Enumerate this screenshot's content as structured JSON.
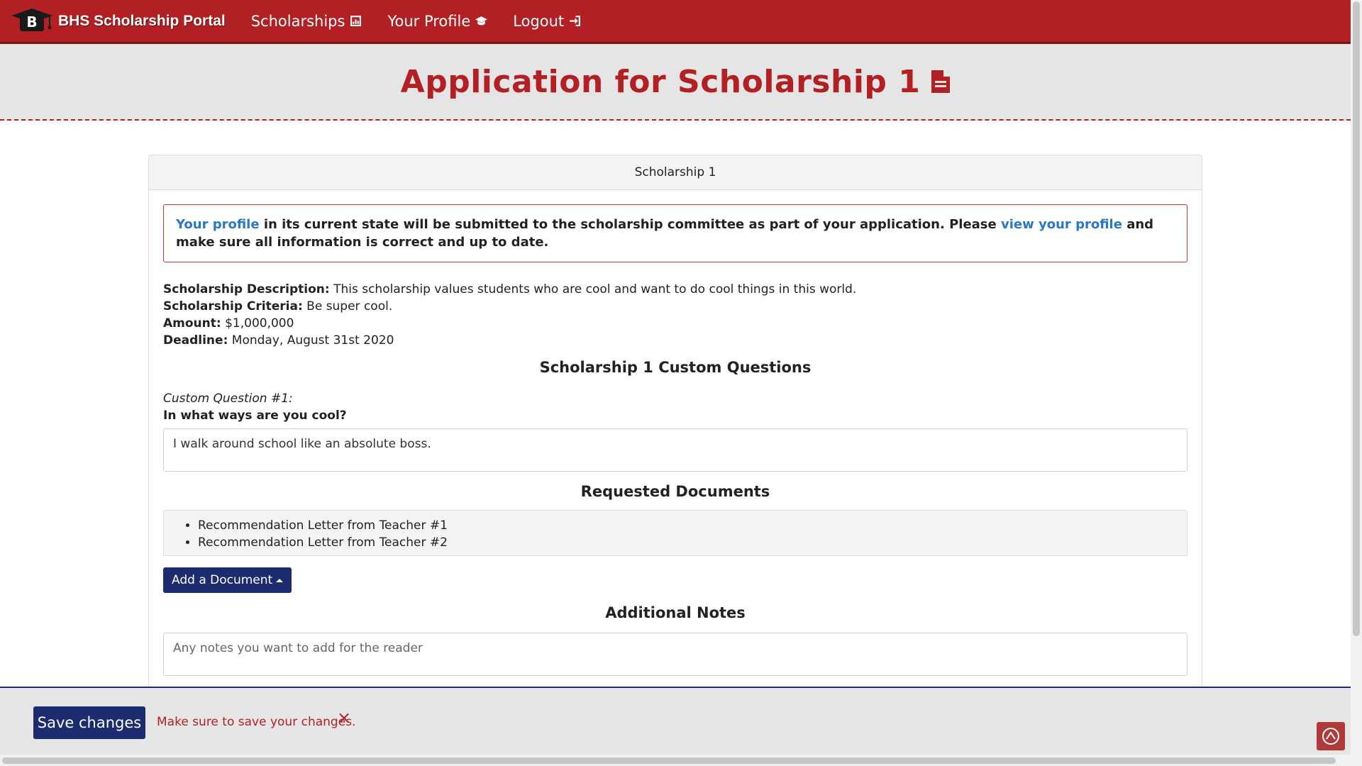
{
  "nav": {
    "brand_letter": "B",
    "brand_name": "BHS Scholarship Portal",
    "items": [
      {
        "label": "Scholarships",
        "icon": "chart-icon"
      },
      {
        "label": "Your Profile",
        "icon": "graduation-cap-icon"
      },
      {
        "label": "Logout",
        "icon": "logout-icon"
      }
    ]
  },
  "header": {
    "title": "Application for Scholarship 1",
    "icon": "document-icon"
  },
  "card": {
    "title": "Scholarship 1",
    "alert": {
      "link1": "Your profile",
      "text1": " in its current state will be submitted to the scholarship committee as part of your application. Please ",
      "link2": "view your profile",
      "text2": " and make sure all information is correct and up to date."
    },
    "info": {
      "description_label": "Scholarship Description:",
      "description_value": " This scholarship values students who are cool and want to do cool things in this world.",
      "criteria_label": "Scholarship Criteria:",
      "criteria_value": " Be super cool.",
      "amount_label": "Amount:",
      "amount_value": " $1,000,000",
      "deadline_label": "Deadline:",
      "deadline_value": " Monday, August 31st 2020"
    },
    "custom_questions": {
      "title": "Scholarship 1 Custom Questions",
      "questions": [
        {
          "number": "Custom Question #1:",
          "text": "In what ways are you cool?",
          "answer": "I walk around school like an absolute boss."
        }
      ]
    },
    "documents": {
      "title": "Requested Documents",
      "items": [
        "Recommendation Letter from Teacher #1",
        "Recommendation Letter from Teacher #2"
      ],
      "add_button": "Add a Document"
    },
    "notes": {
      "title": "Additional Notes",
      "placeholder": "Any notes you want to add for the reader"
    }
  },
  "save_bar": {
    "button": "Save changes",
    "message": "Make sure to save your changes.",
    "close": "×"
  },
  "colors": {
    "brand_red": "#b32024",
    "navy": "#1c2c6e",
    "link_blue": "#2a78c5"
  }
}
